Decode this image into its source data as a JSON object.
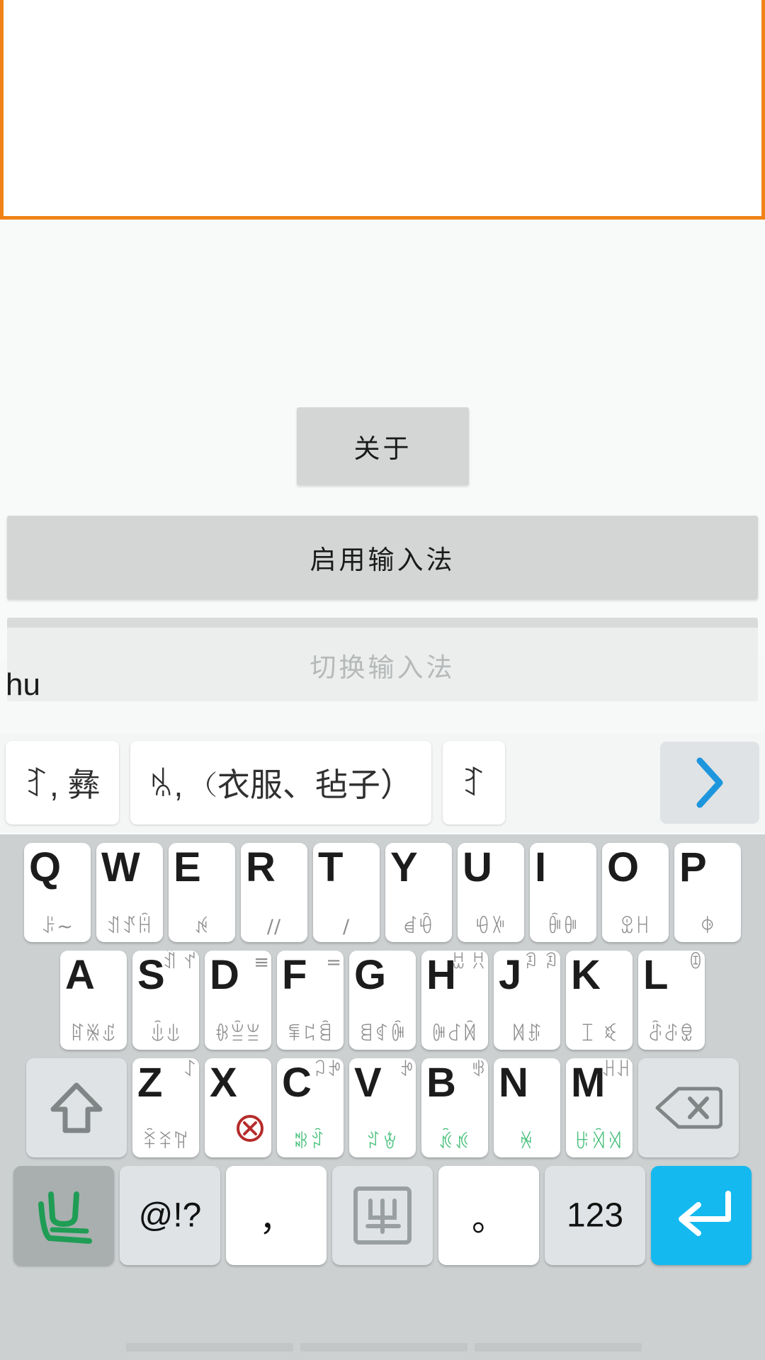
{
  "textfield": {
    "value": "",
    "placeholder": ""
  },
  "settings": {
    "about_label": "关于",
    "enable_ime_label": "启用输入法",
    "switch_ime_label": "切换输入法"
  },
  "composing": {
    "text": "hu"
  },
  "candidates": {
    "items": [
      {
        "text": "ꆈ, 彝"
      },
      {
        "text": "ꁱ, （衣服、毡子）"
      },
      {
        "text": "ꆈ"
      }
    ],
    "expand_icon": "chevron-right-icon"
  },
  "keyboard": {
    "rows": [
      [
        {
          "main": "Q",
          "tr": "",
          "bottom": "ꌠ~"
        },
        {
          "main": "W",
          "tr": "",
          "bottom": "ꀊꀋꀌ"
        },
        {
          "main": "E",
          "tr": "",
          "bottom": "ꉌ"
        },
        {
          "main": "R",
          "tr": "",
          "bottom": "//"
        },
        {
          "main": "T",
          "tr": "",
          "bottom": "/"
        },
        {
          "main": "Y",
          "tr": "",
          "bottom": "ꀸꀹ"
        },
        {
          "main": "U",
          "tr": "",
          "bottom": "ꀺꀻ"
        },
        {
          "main": "I",
          "tr": "",
          "bottom": "ꀼꀽ"
        },
        {
          "main": "O",
          "tr": "",
          "bottom": "ꀾꀿ"
        },
        {
          "main": "P",
          "tr": "",
          "bottom": "ꂈ"
        }
      ],
      [
        {
          "main": "A",
          "tr": "",
          "bottom": "ꍏꍐꍑ"
        },
        {
          "main": "S",
          "tr": "ꀉ ꀈ",
          "bottom": "ꍒꍓ"
        },
        {
          "main": "D",
          "tr": "≡",
          "bottom": "ꁆꁇꁈ"
        },
        {
          "main": "F",
          "tr": "=",
          "bottom": "ꁉꁊꁋ"
        },
        {
          "main": "G",
          "tr": "",
          "bottom": "ꁌꁍꁎ"
        },
        {
          "main": "H",
          "tr": "ꀠ ꀡ",
          "bottom": "ꁏꁐꁑ"
        },
        {
          "main": "J",
          "tr": "ꀢ ꀣ",
          "bottom": "ꁒꁓ"
        },
        {
          "main": "K",
          "tr": "",
          "bottom": "ꀤ ꀥ"
        },
        {
          "main": "L",
          "tr": "ꀦ",
          "bottom": "ꁔꁕꁖ"
        }
      ],
      [
        {
          "main": "shift-icon",
          "type": "shift"
        },
        {
          "main": "Z",
          "tr": "ꋍ",
          "bottom": "ꋎꋏꋐ"
        },
        {
          "main": "X",
          "tr": "delete-circle-icon",
          "bottom": ""
        },
        {
          "main": "C",
          "tr": "ꃀꃁ",
          "bottom": "ꄀꄁ"
        },
        {
          "main": "V",
          "tr": "ꃂ",
          "bottom": "ꄂꄃ"
        },
        {
          "main": "B",
          "tr": "ꃃ",
          "bottom": "ꄄꄅ"
        },
        {
          "main": "N",
          "tr": "",
          "bottom": "ꄆ"
        },
        {
          "main": "M",
          "tr": "ꃄꃅ",
          "bottom": "ꄇꄈꄉ"
        },
        {
          "main": "backspace-icon",
          "type": "bksp"
        }
      ],
      [
        {
          "main": "lang-switch-icon",
          "type": "lang"
        },
        {
          "main": "@!?",
          "type": "sym"
        },
        {
          "main": "，",
          "type": "punct"
        },
        {
          "main": "yi-mode-icon",
          "type": "yibox"
        },
        {
          "main": "。",
          "type": "punct"
        },
        {
          "main": "123",
          "type": "num"
        },
        {
          "main": "enter-icon",
          "type": "enter"
        }
      ]
    ]
  },
  "colors": {
    "accent_orange": "#f08317",
    "enter_blue": "#14b9ef",
    "chevron_blue": "#1e96dd",
    "key_white": "#ffffff",
    "key_gray": "#dfe3e5",
    "keyboard_bg": "#ccd0d1",
    "sub_glyph_gray": "#8d8d8d",
    "green_glyph": "#1f9d55",
    "delete_red": "#b62b2b"
  }
}
